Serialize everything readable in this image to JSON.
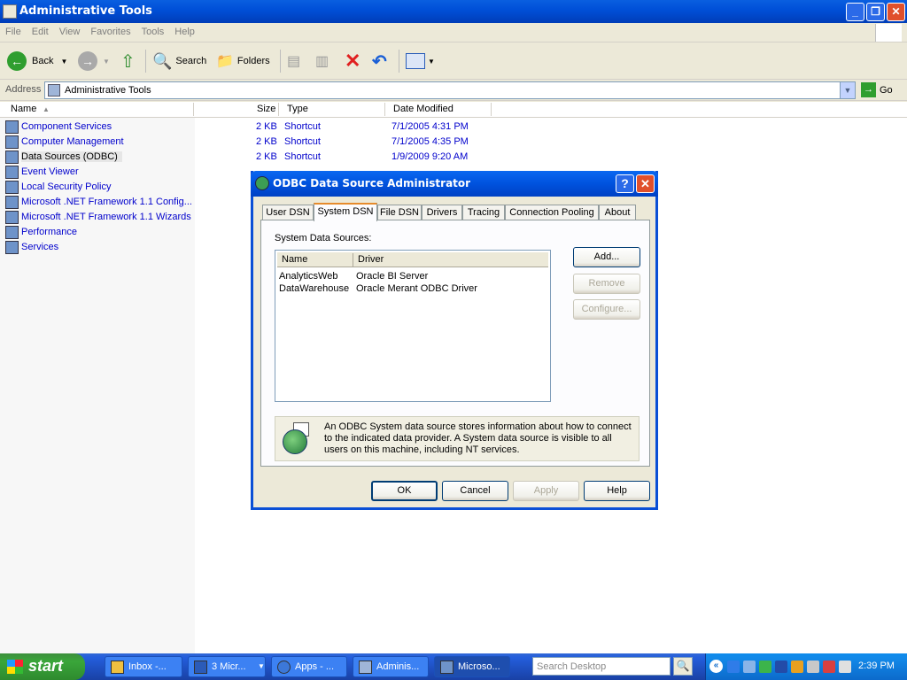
{
  "window": {
    "title": "Administrative Tools"
  },
  "menu": [
    "File",
    "Edit",
    "View",
    "Favorites",
    "Tools",
    "Help"
  ],
  "toolbar": {
    "back": "Back",
    "search": "Search",
    "folders": "Folders"
  },
  "address": {
    "label": "Address",
    "value": "Administrative Tools",
    "go": "Go"
  },
  "columns": {
    "name": "Name",
    "size": "Size",
    "type": "Type",
    "date": "Date Modified"
  },
  "files": [
    {
      "name": "Component Services",
      "size": "2 KB",
      "type": "Shortcut",
      "date": "7/1/2005 4:31 PM"
    },
    {
      "name": "Computer Management",
      "size": "2 KB",
      "type": "Shortcut",
      "date": "7/1/2005 4:35 PM"
    },
    {
      "name": "Data Sources (ODBC)",
      "size": "2 KB",
      "type": "Shortcut",
      "date": "1/9/2009 9:20 AM"
    },
    {
      "name": "Event Viewer"
    },
    {
      "name": "Local Security Policy"
    },
    {
      "name": "Microsoft .NET Framework 1.1 Config..."
    },
    {
      "name": "Microsoft .NET Framework 1.1 Wizards"
    },
    {
      "name": "Performance"
    },
    {
      "name": "Services"
    }
  ],
  "dialog": {
    "title": "ODBC Data Source Administrator",
    "tabs": [
      "User DSN",
      "System DSN",
      "File DSN",
      "Drivers",
      "Tracing",
      "Connection Pooling",
      "About"
    ],
    "section_label": "System Data Sources:",
    "list_headers": {
      "name": "Name",
      "driver": "Driver"
    },
    "sources": [
      {
        "name": "AnalyticsWeb",
        "driver": "Oracle BI Server"
      },
      {
        "name": "DataWarehouse",
        "driver": "Oracle Merant ODBC Driver"
      }
    ],
    "buttons": {
      "add": "Add...",
      "remove": "Remove",
      "configure": "Configure..."
    },
    "info": "An ODBC System data source stores information about how to connect to the indicated data provider.  A System data source is visible to all users on this machine, including NT services.",
    "footer": {
      "ok": "OK",
      "cancel": "Cancel",
      "apply": "Apply",
      "help": "Help"
    }
  },
  "taskbar": {
    "start": "start",
    "tasks": [
      "Inbox -...",
      "3 Micr...",
      "Apps - ...",
      "Adminis...",
      "Microso..."
    ],
    "search_placeholder": "Search Desktop",
    "clock": "2:39 PM"
  }
}
